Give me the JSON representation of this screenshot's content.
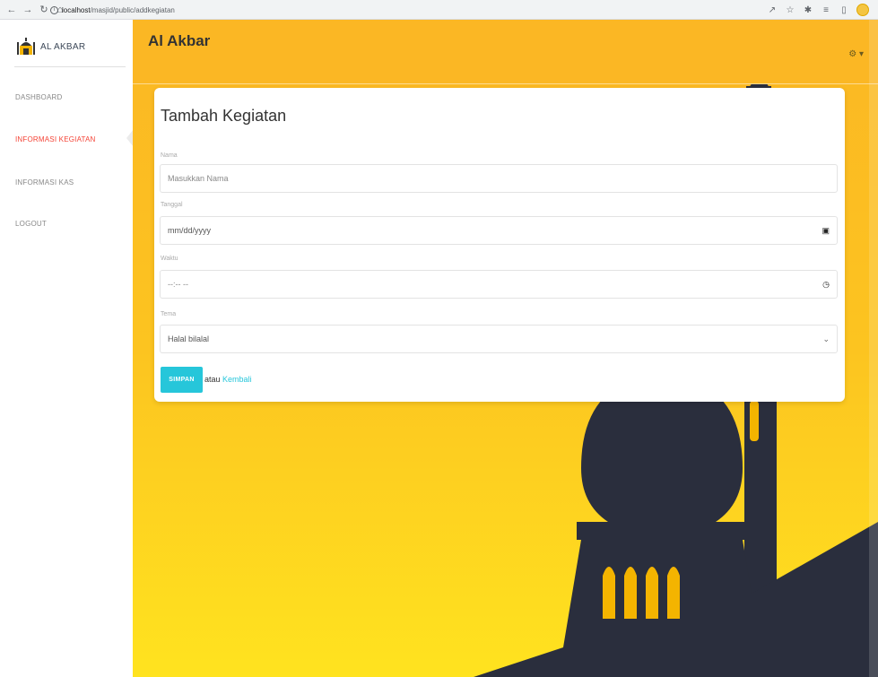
{
  "browser": {
    "url_host": "localhost",
    "url_path": "/masjid/public/addkegiatan"
  },
  "sidebar": {
    "brand": "AL AKBAR",
    "items": [
      {
        "label": "DASHBOARD"
      },
      {
        "label": "INFORMASI KEGIATAN"
      },
      {
        "label": "INFORMASI KAS"
      },
      {
        "label": "LOGOUT"
      }
    ]
  },
  "header": {
    "title": "Al Akbar"
  },
  "form": {
    "title": "Tambah Kegiatan",
    "nama_label": "Nama",
    "nama_placeholder": "Masukkan Nama",
    "tanggal_label": "Tanggal",
    "tanggal_value": "mm/dd/yyyy",
    "waktu_label": "Waktu",
    "waktu_value": "--:-- --",
    "tema_label": "Tema",
    "tema_value": "Halal bilalal",
    "save_label": "SIMPAN",
    "alt_text": "atau",
    "back_label": "Kembali"
  },
  "colors": {
    "accent": "#26c6da",
    "active_menu": "#f44336",
    "background_top": "#fbb724",
    "background_bottom": "#ffe31f",
    "silhouette": "#2a2e3d"
  },
  "icons": {
    "back": "arrow-left-icon",
    "forward": "arrow-right-icon",
    "reload": "reload-icon",
    "home": "home-icon",
    "settings": "gear-icon",
    "calendar": "calendar-icon",
    "clock": "clock-icon",
    "dropdown": "chevron-down-icon"
  }
}
